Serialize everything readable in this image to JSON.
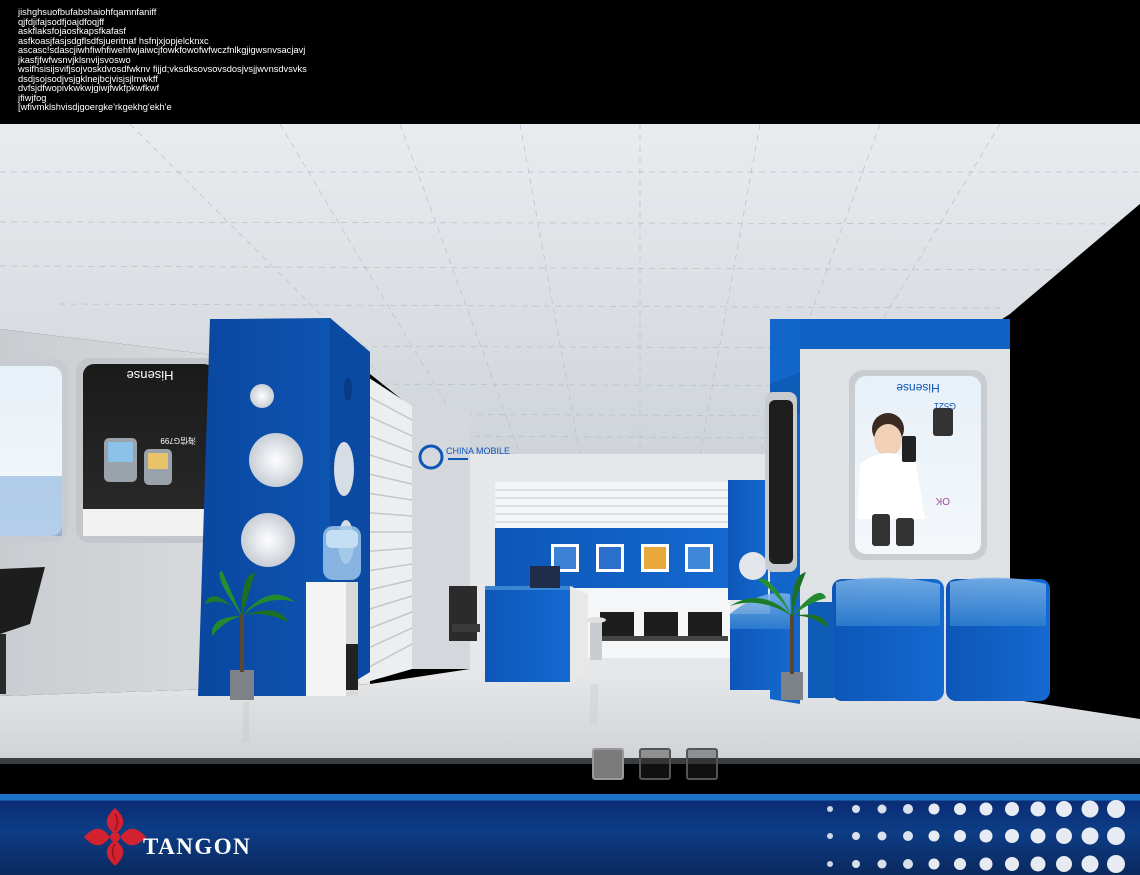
{
  "notes": [
    "jishghsuofbufabshaiohfqamnfaniff",
    "qjfdjifajsodfjoajdfoqjff",
    "askflaksfojaosfkapsfkafasf",
    "asfkoasjfasjsdgflsdfsjueritnaf hsfnjxjopjelcknxc",
    "ascasc!sdascjiwhfiwhfiwehfwjaiwcjfowkfowofwfwczfnlkgjigwsnvsacjavj",
    "jkasfjfwfwsnvjklsnvijsvoswo",
    "wsifhsisijsvifjsojvoskdvosdfwknv fijjd;vksdksovsovsdosjvsjjwvnsdvsvks",
    "dsdjsojsodjvsjgklnejbcjvisjsjlmwkff",
    "dvfsjdfwopivkwkwjgiwjfwkfpkwfkwf",
    "jfiwjfog",
    "[wfivmklshvisdjgoergke'rkgekhg'ekh'e"
  ],
  "scene": {
    "poster_left": {
      "brand": "Hisense",
      "model_label": "海信G799"
    },
    "poster_right": {
      "brand": "Hisense",
      "model_label": "G521",
      "tagline": "OK"
    },
    "wall_logo_text": "CHINA MOBILE"
  },
  "footer": {
    "brand": "TANGON",
    "colors": {
      "band": "#0d3d86",
      "stripe": "#1d73c8",
      "logo": "#d2212f"
    }
  },
  "nav": {
    "thumb_count": 3,
    "active_index": 0
  }
}
